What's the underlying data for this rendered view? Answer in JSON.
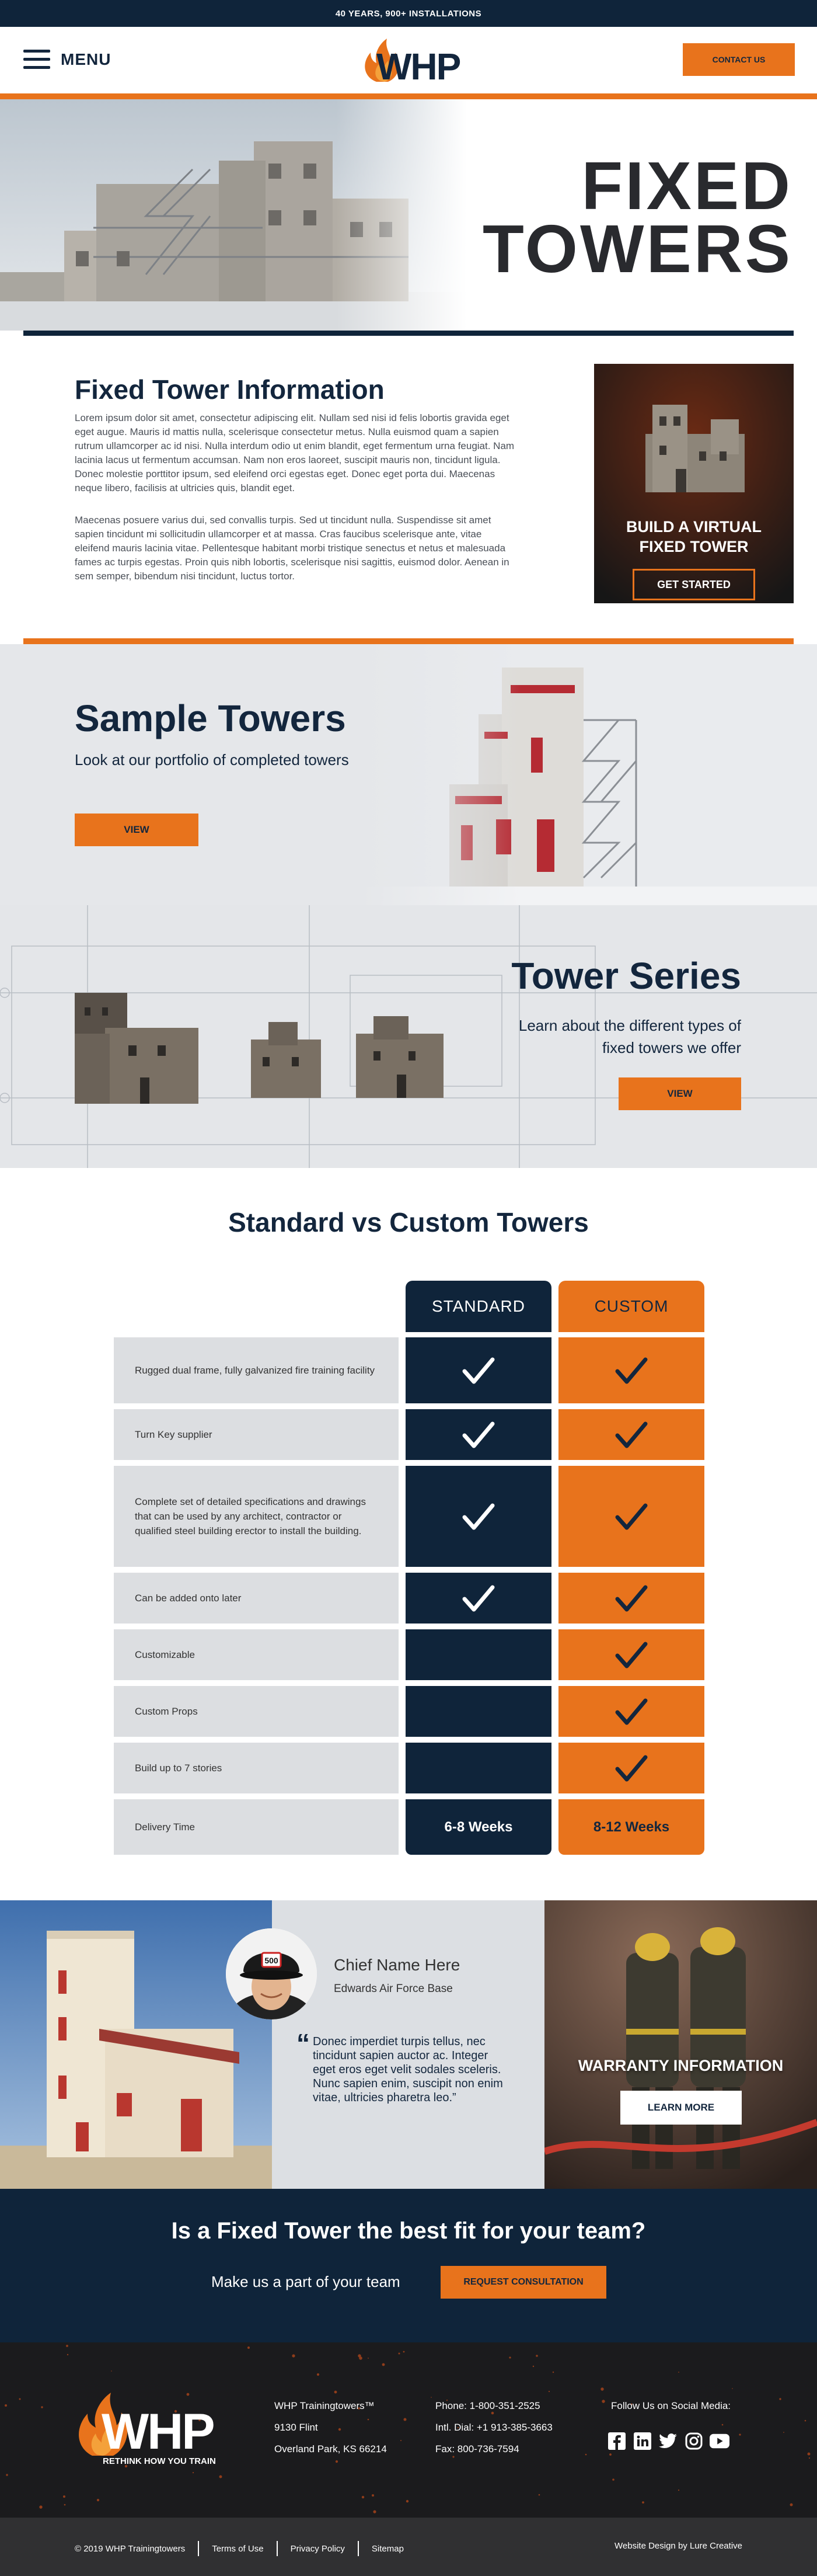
{
  "topbar": {
    "text": "40 YEARS, 900+ INSTALLATIONS"
  },
  "header": {
    "menu_label": "MENU",
    "logo_text": "WHP",
    "contact_label": "CONTACT US"
  },
  "hero": {
    "title_line1": "FIXED",
    "title_line2": "TOWERS"
  },
  "info": {
    "title": "Fixed Tower Information",
    "p1": "Lorem ipsum dolor sit amet, consectetur adipiscing elit. Nullam sed nisi id felis lobortis gravida eget eget augue. Mauris id mattis nulla, scelerisque consectetur metus. Nulla euismod quam a sapien rutrum ullamcorper ac id nisi. Nulla interdum odio ut enim blandit, eget fermentum urna feugiat. Nam lacinia lacus ut fermentum accumsan. Nam non eros laoreet, suscipit mauris non, tincidunt ligula. Donec molestie porttitor ipsum, sed eleifend orci egestas eget. Donec eget porta dui. Maecenas neque libero, facilisis at ultricies quis, blandit eget.",
    "p2": "Maecenas posuere varius dui, sed convallis turpis. Sed ut tincidunt nulla. Suspendisse sit amet sapien tincidunt mi sollicitudin ullamcorper et at massa. Cras faucibus scelerisque ante, vitae eleifend mauris lacinia vitae. Pellentesque habitant morbi tristique senectus et netus et malesuada fames ac turpis egestas. Proin quis nibh lobortis, scelerisque nisi sagittis, euismod dolor. Aenean in sem semper, bibendum nisi tincidunt, luctus tortor.",
    "vtour_line1": "BUILD A VIRTUAL",
    "vtour_line2": "FIXED TOWER",
    "vtour_button": "GET STARTED"
  },
  "sample": {
    "title": "Sample Towers",
    "subtitle": "Look at our portfolio of completed towers",
    "button": "VIEW"
  },
  "series": {
    "title": "Tower Series",
    "subtitle": "Learn about the different types of fixed towers we offer",
    "button": "VIEW"
  },
  "compare": {
    "title": "Standard vs Custom Towers",
    "col_standard": "STANDARD",
    "col_custom": "CUSTOM",
    "rows": [
      {
        "label": "Rugged dual frame, fully galvanized fire training facility",
        "standard": true,
        "custom": true
      },
      {
        "label": "Turn Key supplier",
        "standard": true,
        "custom": true
      },
      {
        "label": "Complete set of detailed specifications and drawings that can be used by any architect, contractor or qualified steel building erector to install the building.",
        "standard": true,
        "custom": true
      },
      {
        "label": "Can be added onto later",
        "standard": true,
        "custom": true
      },
      {
        "label": "Customizable",
        "standard": false,
        "custom": true
      },
      {
        "label": "Custom Props",
        "standard": false,
        "custom": true
      },
      {
        "label": "Build up to 7 stories",
        "standard": false,
        "custom": true
      },
      {
        "label": "Delivery Time",
        "standard": "6-8 Weeks",
        "custom": "8-12 Weeks"
      }
    ]
  },
  "testimonial": {
    "name": "Chief Name Here",
    "base": "Edwards Air Force Base",
    "quote": "Donec imperdiet turpis tellus, nec tincidunt sapien auctor ac. Integer eget eros eget velit sodales sceleris. Nunc sapien enim, suscipit non enim vitae, ultricies pharetra leo.”",
    "badge": "500"
  },
  "warranty": {
    "title": "WARRANTY INFORMATION",
    "button": "LEARN MORE"
  },
  "cta": {
    "title": "Is a Fixed Tower the best fit for your team?",
    "subtitle": "Make us a part of your team",
    "button": "REQUEST CONSULTATION"
  },
  "footer": {
    "logo_text": "WHP",
    "tagline": "RETHINK HOW YOU TRAIN",
    "address": [
      "WHP Trainingtowers™",
      "9130 Flint",
      "Overland Park, KS 66214"
    ],
    "phones": [
      "Phone: 1-800-351-2525",
      "Intl. Dial: +1 913-385-3663",
      "Fax: 800-736-7594"
    ],
    "social_label": "Follow Us on Social Media:",
    "social_icons": [
      "facebook-icon",
      "linkedin-icon",
      "twitter-icon",
      "instagram-icon",
      "youtube-icon"
    ]
  },
  "legal": {
    "copyright": "© 2019 WHP Trainingtowers",
    "links": [
      "Terms of Use",
      "Privacy Policy",
      "Sitemap"
    ],
    "credit": "Website Design by Lure Creative"
  },
  "colors": {
    "navy": "#0f243a",
    "orange": "#e8731c",
    "gray": "#dcdee1"
  }
}
